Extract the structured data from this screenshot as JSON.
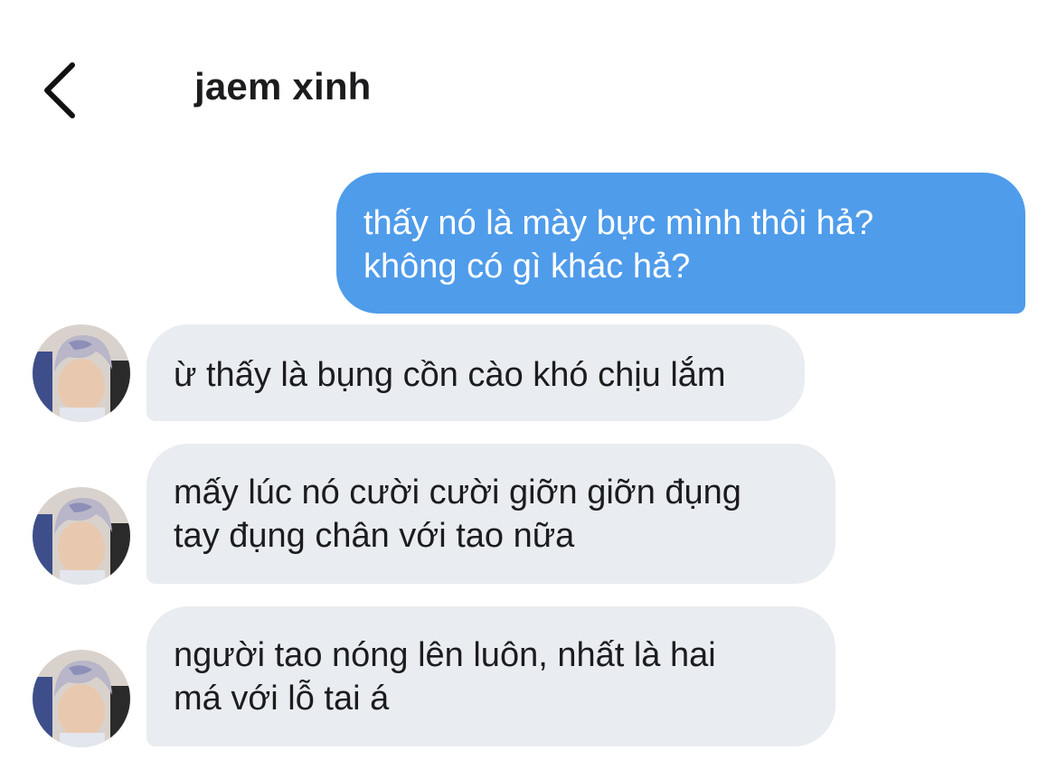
{
  "header": {
    "back_icon": "chevron-left-icon",
    "title": "jaem xinh"
  },
  "messages": [
    {
      "direction": "sent",
      "text": "thấy nó là mày bực mình thôi hả?\nkhông có gì khác hả?"
    },
    {
      "direction": "received",
      "text": "ừ thấy là bụng cồn cào khó chịu lắm"
    },
    {
      "direction": "received",
      "text": "mấy lúc nó cười cười giỡn giỡn đụng\ntay đụng chân với tao nữa"
    },
    {
      "direction": "received",
      "text": "người tao nóng lên luôn, nhất là hai\nmá với lỗ tai á"
    }
  ],
  "colors": {
    "sent_bubble": "#4f9ceb",
    "received_bubble": "#e9ecf0",
    "text": "#1c1c1e",
    "background": "#ffffff"
  }
}
